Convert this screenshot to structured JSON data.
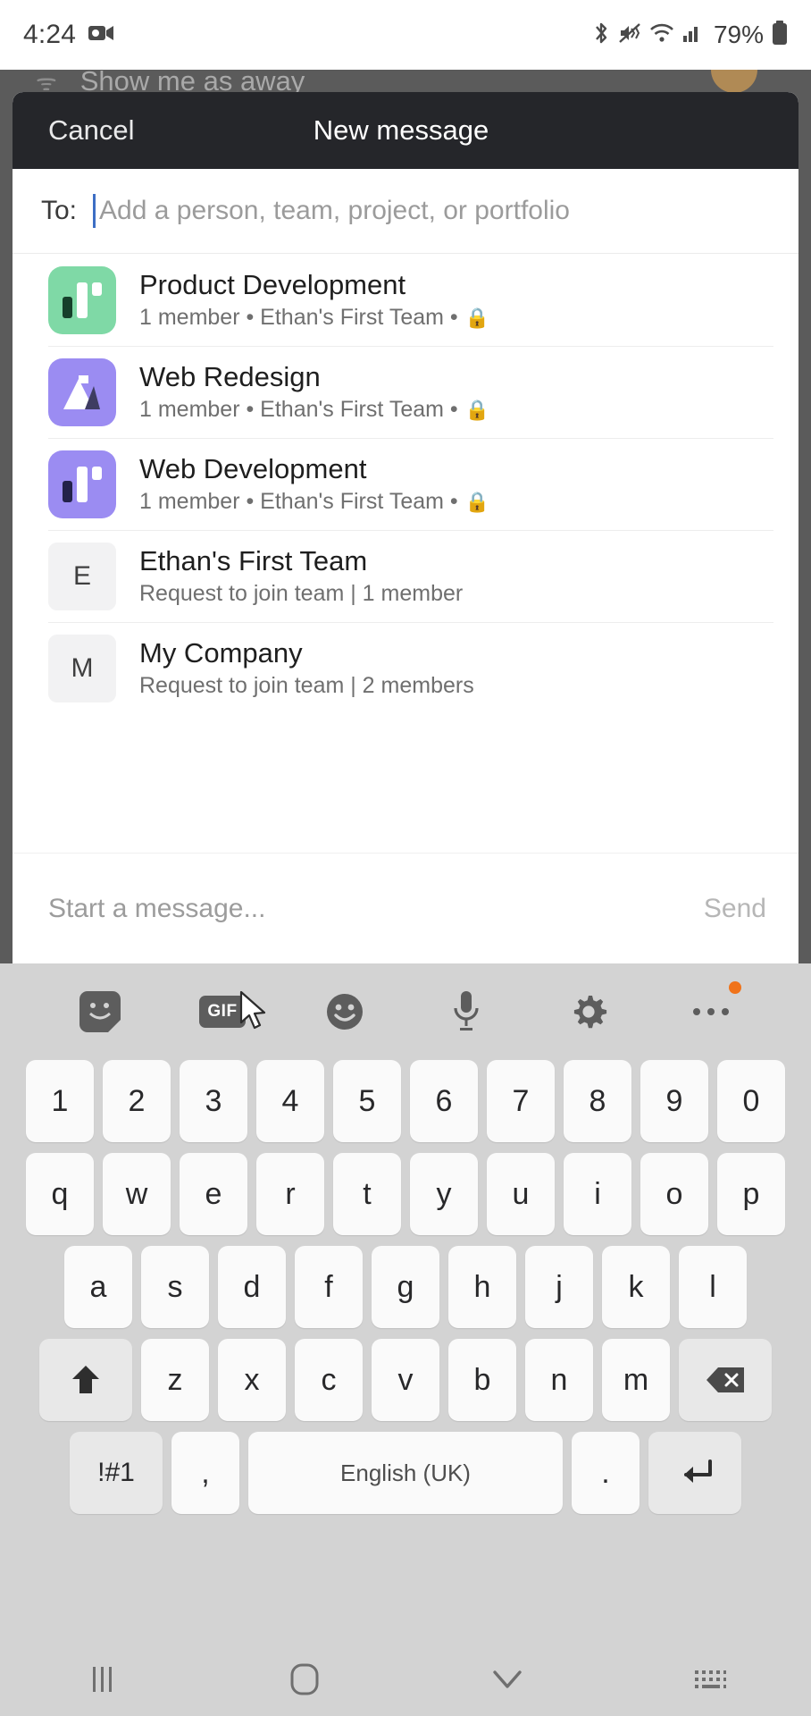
{
  "status_bar": {
    "time": "4:24",
    "battery_percent": "79%",
    "icons": [
      "video-camera-icon",
      "bluetooth-icon",
      "mute-vibrate-icon",
      "wifi-icon",
      "cellular-signal-icon",
      "battery-icon"
    ]
  },
  "background": {
    "row_label": "Show me as away",
    "row_icon": "glasses-icon"
  },
  "sheet": {
    "cancel_label": "Cancel",
    "title": "New message",
    "to_label": "To:",
    "to_value": "",
    "to_placeholder": "Add a person, team, project, or portfolio"
  },
  "results": [
    {
      "title": "Product Development",
      "subtitle": "1 member • Ethan's First Team •",
      "avatar_type": "board",
      "avatar_color": "#7fd9a6",
      "bar_dark": "#16402b",
      "has_lock": true
    },
    {
      "title": "Web Redesign",
      "subtitle": "1 member • Ethan's First Team •",
      "avatar_type": "mountain",
      "avatar_color": "#9b8cf2",
      "bar_dark": "#3e3c62",
      "has_lock": true
    },
    {
      "title": "Web Development",
      "subtitle": "1 member • Ethan's First Team •",
      "avatar_type": "board",
      "avatar_color": "#9b8cf2",
      "bar_dark": "#23224a",
      "has_lock": true
    },
    {
      "title": "Ethan's First Team",
      "subtitle": "Request to join team | 1 member",
      "avatar_type": "letter",
      "avatar_letter": "E",
      "has_lock": false
    },
    {
      "title": "My Company",
      "subtitle": "Request to join team | 2 members",
      "avatar_type": "letter",
      "avatar_letter": "M",
      "has_lock": false
    }
  ],
  "composer": {
    "placeholder": "Start a message...",
    "send_label": "Send"
  },
  "keyboard": {
    "toolbar": [
      {
        "name": "sticker-icon"
      },
      {
        "name": "gif-icon",
        "label": "GIF"
      },
      {
        "name": "emoji-icon"
      },
      {
        "name": "microphone-icon"
      },
      {
        "name": "gear-icon"
      },
      {
        "name": "more-options-icon",
        "badge": true
      }
    ],
    "row_numbers": [
      "1",
      "2",
      "3",
      "4",
      "5",
      "6",
      "7",
      "8",
      "9",
      "0"
    ],
    "row_top": [
      "q",
      "w",
      "e",
      "r",
      "t",
      "y",
      "u",
      "i",
      "o",
      "p"
    ],
    "row_home": [
      "a",
      "s",
      "d",
      "f",
      "g",
      "h",
      "j",
      "k",
      "l"
    ],
    "row_bottom": [
      "z",
      "x",
      "c",
      "v",
      "b",
      "n",
      "m"
    ],
    "shift_key": "shift-icon",
    "backspace_key": "backspace-icon",
    "symbols_key": "!#1",
    "comma_key": ",",
    "space_key": "English (UK)",
    "period_key": ".",
    "enter_key": "enter-icon"
  },
  "navbar": {
    "recents": "recents-icon",
    "home": "home-icon",
    "hide_keyboard": "chevron-down-icon",
    "keyboard_switch": "keyboard-icon"
  },
  "colors": {
    "accent_purple": "#9b8cf2",
    "accent_green": "#7fd9a6",
    "header_dark": "#25262a",
    "caret_blue": "#3d6ec4",
    "badge_orange": "#f0731a"
  }
}
